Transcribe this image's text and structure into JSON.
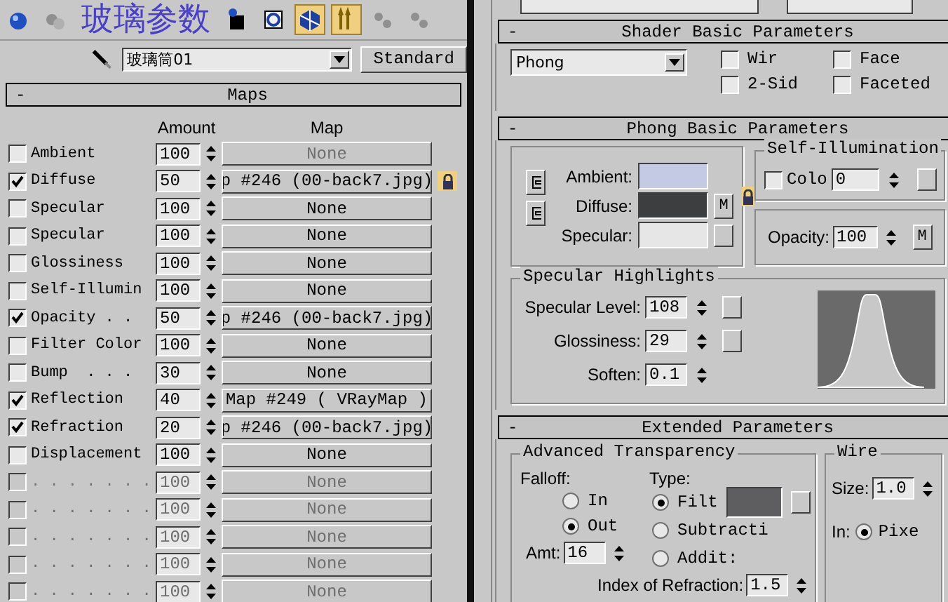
{
  "annotation": "玻璃参数",
  "toolbar": [
    {
      "selected": false
    },
    {
      "selected": false
    },
    {
      "selected": false
    },
    {
      "selected": false
    },
    {
      "selected": true
    },
    {
      "selected": true
    },
    {
      "selected": false
    },
    {
      "selected": false
    }
  ],
  "material": {
    "name": "玻璃筒01",
    "type": "Standard"
  },
  "maps": {
    "collapse": "-",
    "title": "Maps",
    "columns": [
      "Amount",
      "Map"
    ],
    "rows": [
      {
        "label": "Ambient",
        "checked": false,
        "disabled": false,
        "amount": "100",
        "map": "None",
        "map_disabled": true
      },
      {
        "label": "Diffuse",
        "checked": true,
        "disabled": false,
        "amount": "50",
        "map": "p #246 (00-back7.jpg)",
        "map_disabled": false
      },
      {
        "label": "Specular",
        "checked": false,
        "disabled": false,
        "amount": "100",
        "map": "None",
        "map_disabled": false
      },
      {
        "label": "Specular",
        "checked": false,
        "disabled": false,
        "amount": "100",
        "map": "None",
        "map_disabled": false
      },
      {
        "label": "Glossiness",
        "checked": false,
        "disabled": false,
        "amount": "100",
        "map": "None",
        "map_disabled": false
      },
      {
        "label": "Self-Illumin",
        "checked": false,
        "disabled": false,
        "amount": "100",
        "map": "None",
        "map_disabled": false
      },
      {
        "label": "Opacity . .",
        "checked": true,
        "disabled": false,
        "amount": "50",
        "map": "p #246 (00-back7.jpg)",
        "map_disabled": false
      },
      {
        "label": "Filter Color",
        "checked": false,
        "disabled": false,
        "amount": "100",
        "map": "None",
        "map_disabled": false
      },
      {
        "label": "Bump  . . .",
        "checked": false,
        "disabled": false,
        "amount": "30",
        "map": "None",
        "map_disabled": false
      },
      {
        "label": "Reflection",
        "checked": true,
        "disabled": false,
        "amount": "40",
        "map": "Map #249  ( VRayMap )",
        "map_disabled": false
      },
      {
        "label": "Refraction",
        "checked": true,
        "disabled": false,
        "amount": "20",
        "map": "p #246 (00-back7.jpg)",
        "map_disabled": false
      },
      {
        "label": "Displacement",
        "checked": false,
        "disabled": false,
        "amount": "100",
        "map": "None",
        "map_disabled": false
      },
      {
        "label": ". . . . . . .",
        "checked": false,
        "disabled": true,
        "amount": "100",
        "map": "None",
        "map_disabled": true
      },
      {
        "label": ". . . . . . .",
        "checked": false,
        "disabled": true,
        "amount": "100",
        "map": "None",
        "map_disabled": true
      },
      {
        "label": ". . . . . . .",
        "checked": false,
        "disabled": true,
        "amount": "100",
        "map": "None",
        "map_disabled": true
      },
      {
        "label": ". . . . . . .",
        "checked": false,
        "disabled": true,
        "amount": "100",
        "map": "None",
        "map_disabled": true
      },
      {
        "label": ". . . . . . .",
        "checked": false,
        "disabled": true,
        "amount": "100",
        "map": "None",
        "map_disabled": true
      }
    ]
  },
  "shader": {
    "collapse": "-",
    "title": "Shader Basic Parameters",
    "shader_type": "Phong",
    "options": [
      {
        "label": "Wir",
        "checked": false
      },
      {
        "label": "2-Sid",
        "checked": false
      },
      {
        "label": "Face",
        "checked": false
      },
      {
        "label": "Faceted",
        "checked": false
      }
    ]
  },
  "phong": {
    "collapse": "-",
    "title": "Phong Basic Parameters",
    "colors": [
      {
        "label": "Ambient:",
        "color": "#c4cae4"
      },
      {
        "label": "Diffuse:",
        "color": "#3c3e40"
      },
      {
        "label": "Specular:",
        "color": "#e6e6e6"
      }
    ],
    "diffuse_map_button": "M",
    "self_illumination": {
      "title": "Self-Illumination",
      "label": "Colo",
      "checked": false,
      "value": "0"
    },
    "opacity": {
      "label": "Opacity:",
      "value": "100",
      "map_button": "M"
    },
    "specular_highlights": {
      "title": "Specular Highlights",
      "fields": [
        {
          "label": "Specular Level:",
          "value": "108"
        },
        {
          "label": "Glossiness:",
          "value": "29"
        },
        {
          "label": "Soften:",
          "value": "0.1"
        }
      ]
    }
  },
  "extended": {
    "collapse": "-",
    "title": "Extended Parameters",
    "advanced_transparency": {
      "title": "Advanced Transparency",
      "falloff_label": "Falloff:",
      "type_label": "Type:",
      "falloff": [
        {
          "label": "In",
          "selected": false
        },
        {
          "label": "Out",
          "selected": true
        }
      ],
      "types": [
        {
          "label": "Filt",
          "selected": true
        },
        {
          "label": "Subtracti",
          "selected": false
        },
        {
          "label": "Addit:",
          "selected": false
        }
      ],
      "amount_label": "Amt:",
      "amount": "16",
      "ior_label": "Index of Refraction:",
      "ior": "1.5"
    },
    "wire": {
      "title": "Wire",
      "size_label": "Size:",
      "size": "1.0",
      "in_label": "In:",
      "units": [
        {
          "label": "Pixe",
          "selected": true
        }
      ]
    }
  }
}
